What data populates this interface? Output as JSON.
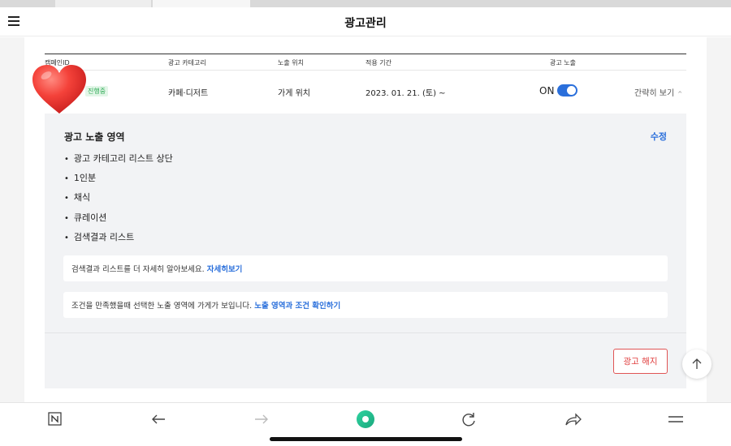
{
  "header": {
    "title": "광고관리"
  },
  "table": {
    "columns": {
      "campaign_id": "캠페인ID",
      "category": "광고 카테고리",
      "position": "노출 위치",
      "period": "적용 기간",
      "exposure": "광고 노출"
    },
    "row": {
      "status": "진행중",
      "category": "카페·디저트",
      "position": "가게 위치",
      "period": "2023. 01. 21. (토) ~",
      "exposure_label": "ON",
      "exposure_on": true,
      "collapse_label": "간략히 보기"
    }
  },
  "panel": {
    "title": "광고 노출 영역",
    "edit_label": "수정",
    "items": [
      "광고 카테고리 리스트 상단",
      "1인분",
      "채식",
      "큐레이션",
      "검색결과 리스트"
    ],
    "info1_text": "검색결과 리스트를 더 자세히 알아보세요.",
    "info1_link": "자세히보기",
    "info2_text": "조건을 만족했을때 선택한 노출 영역에 가게가 보입니다.",
    "info2_link": "노출 영역과 조건 확인하기",
    "cancel_label": "광고 해지"
  },
  "colors": {
    "accent": "#2a6fdb",
    "danger": "#e03e3e",
    "status_green": "#2eaa55",
    "panel_bg": "#f2f3f5"
  },
  "icons": {
    "menu": "hamburger-menu-icon",
    "sticker": "heart-emoji-icon",
    "scroll_top": "arrow-up-icon",
    "bottom_nav": [
      "naver-n-icon",
      "back-arrow-icon",
      "forward-arrow-icon",
      "green-dot-icon",
      "refresh-icon",
      "share-icon",
      "more-menu-icon"
    ]
  }
}
